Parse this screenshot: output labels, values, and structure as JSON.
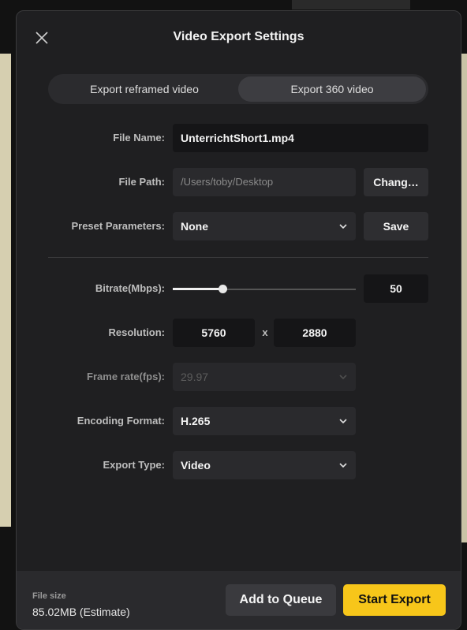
{
  "dialog": {
    "title": "Video Export Settings",
    "close_icon": "close-icon"
  },
  "tabs": [
    {
      "label": "Export reframed video",
      "active": false
    },
    {
      "label": "Export 360 video",
      "active": true
    }
  ],
  "file_name": {
    "label": "File Name:",
    "value": "UnterrichtShort1.mp4"
  },
  "file_path": {
    "label": "File Path:",
    "value": "/Users/toby/Desktop",
    "change_label": "Chang…"
  },
  "preset": {
    "label": "Preset Parameters:",
    "value": "None",
    "save_label": "Save"
  },
  "bitrate": {
    "label": "Bitrate(Mbps):",
    "value": "50",
    "slider_fraction": 0.27
  },
  "resolution": {
    "label": "Resolution:",
    "width": "5760",
    "separator": "x",
    "height": "2880"
  },
  "frame_rate": {
    "label": "Frame rate(fps):",
    "value": "29.97",
    "disabled": true
  },
  "encoding": {
    "label": "Encoding Format:",
    "value": "H.265"
  },
  "export_type": {
    "label": "Export Type:",
    "value": "Video"
  },
  "footer": {
    "file_size_label": "File size",
    "file_size_value": "85.02MB (Estimate)",
    "queue_label": "Add to Queue",
    "start_label": "Start Export"
  },
  "colors": {
    "accent": "#f7c61a",
    "panel": "#1f1f21",
    "field": "#151517"
  },
  "icons": {
    "dropdown": "chevron-down-icon"
  }
}
